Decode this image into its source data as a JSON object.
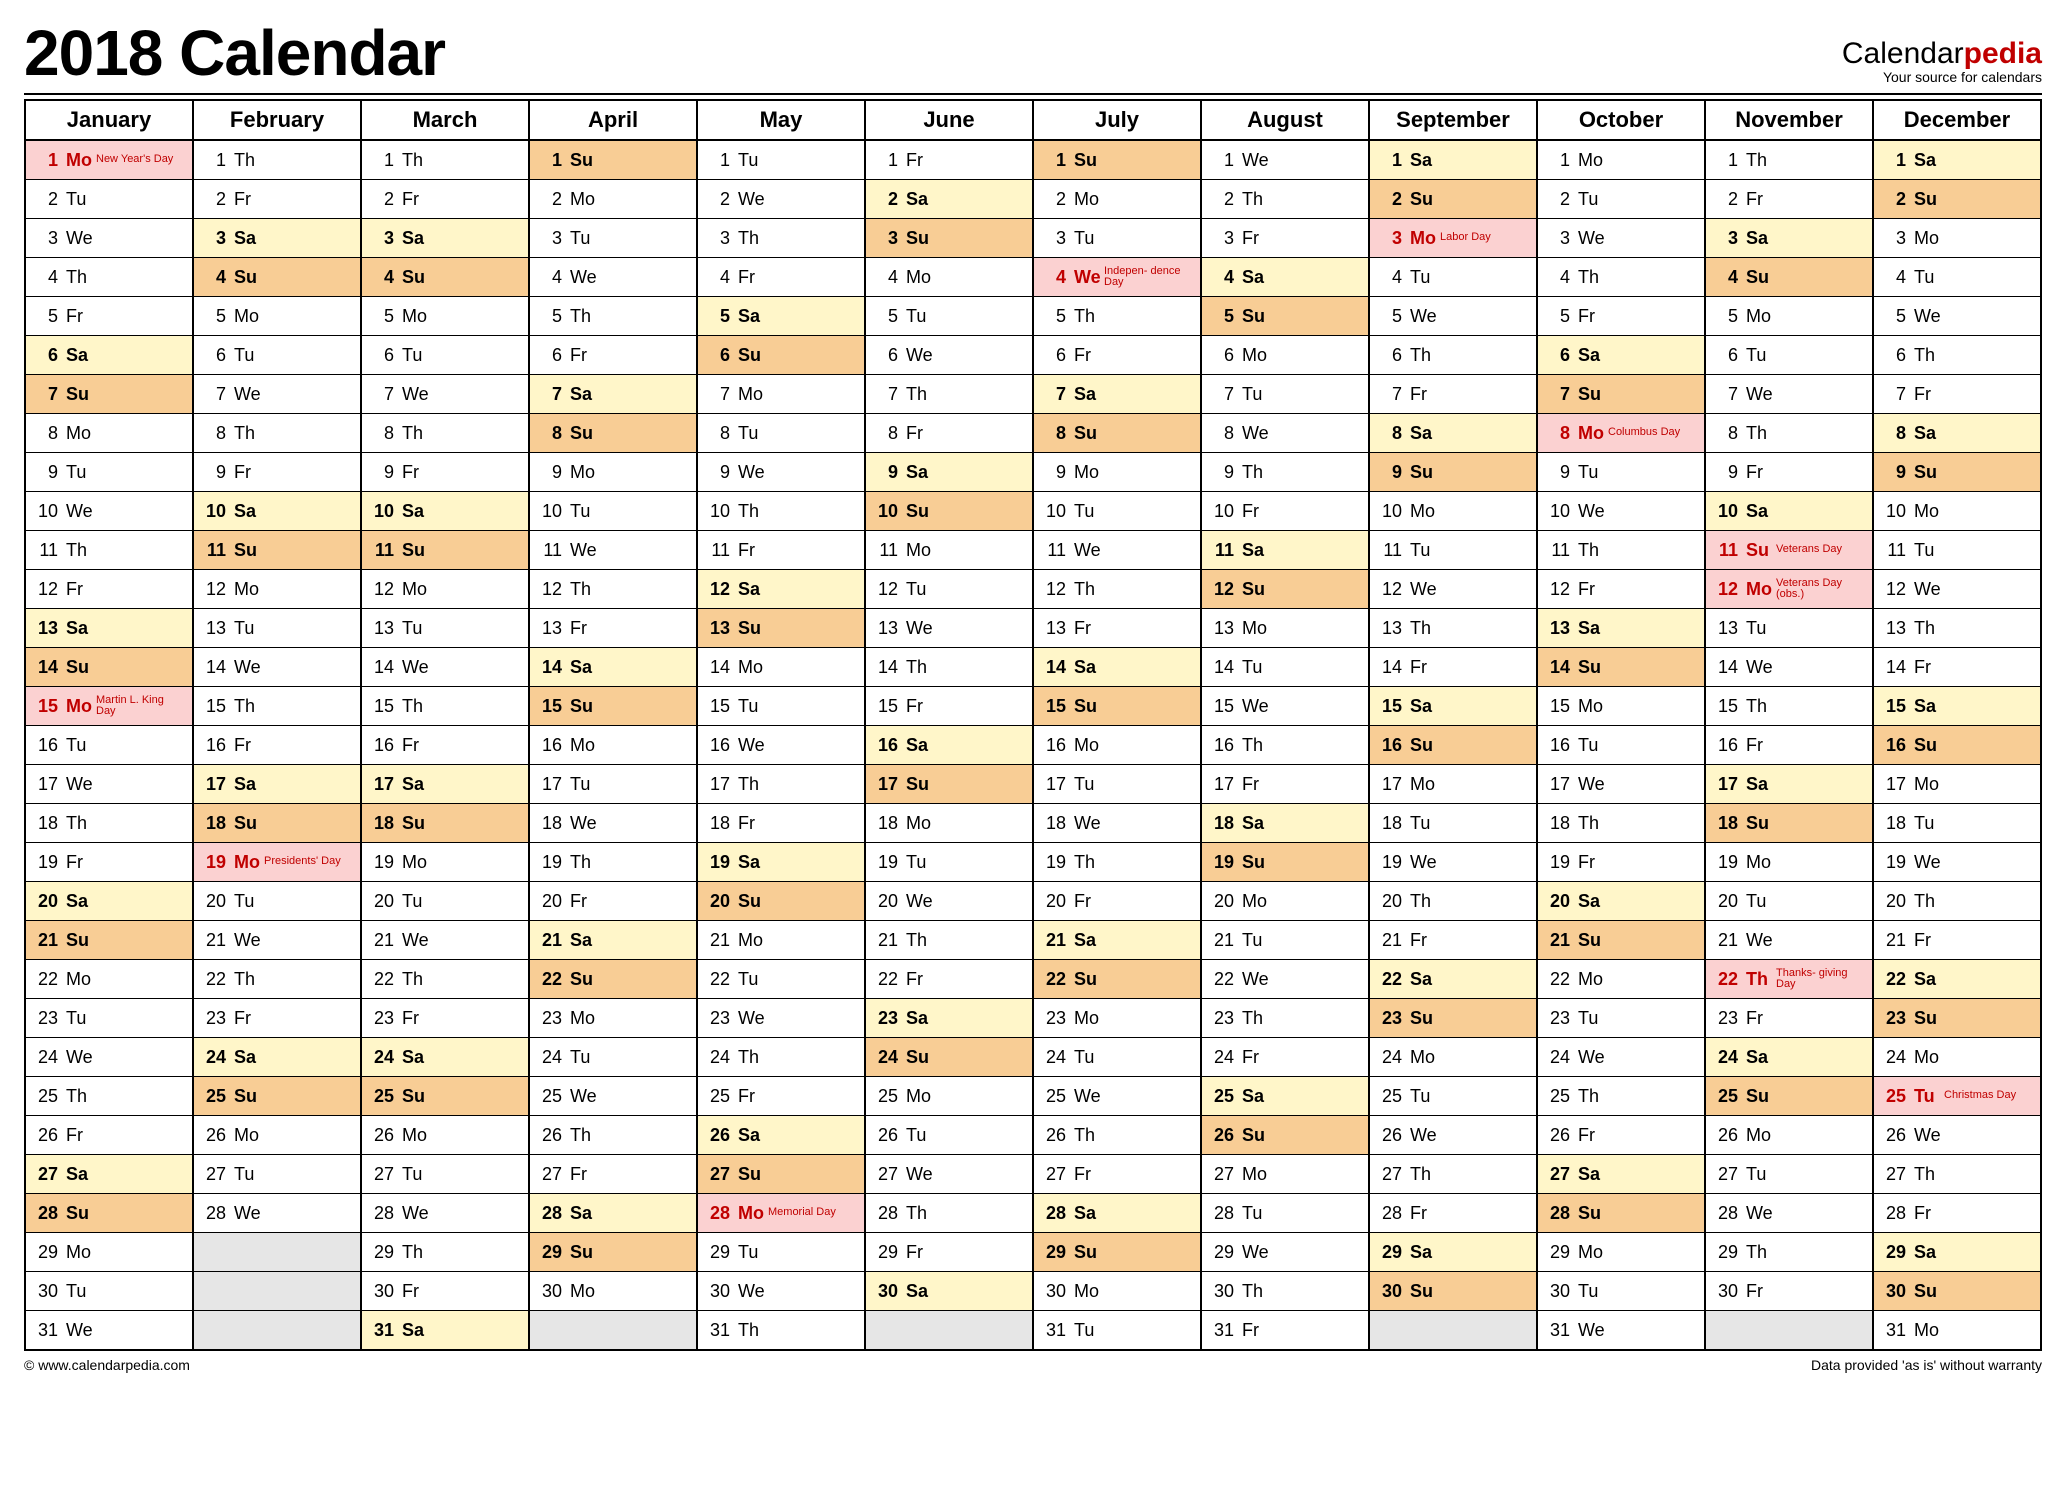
{
  "title": "2018 Calendar",
  "brand": {
    "main1": "Calendar",
    "main2": "pedia",
    "sub": "Your source for calendars"
  },
  "footer": {
    "left": "© www.calendarpedia.com",
    "right": "Data provided 'as is' without warranty"
  },
  "months": [
    "January",
    "February",
    "March",
    "April",
    "May",
    "June",
    "July",
    "August",
    "September",
    "October",
    "November",
    "December"
  ],
  "days_in_month": [
    31,
    28,
    31,
    30,
    31,
    30,
    31,
    31,
    30,
    31,
    30,
    31
  ],
  "first_dow": [
    1,
    4,
    4,
    0,
    2,
    5,
    0,
    3,
    6,
    1,
    4,
    6
  ],
  "dow_labels": [
    "Su",
    "Mo",
    "Tu",
    "We",
    "Th",
    "Fr",
    "Sa"
  ],
  "holidays": {
    "0-1": "New Year's Day",
    "0-15": "Martin L. King Day",
    "1-19": "Presidents' Day",
    "4-28": "Memorial Day",
    "6-4": "Indepen- dence Day",
    "8-3": "Labor Day",
    "9-8": "Columbus Day",
    "10-11": "Veterans Day",
    "10-12": "Veterans Day (obs.)",
    "10-22": "Thanks- giving Day",
    "11-25": "Christmas Day"
  }
}
